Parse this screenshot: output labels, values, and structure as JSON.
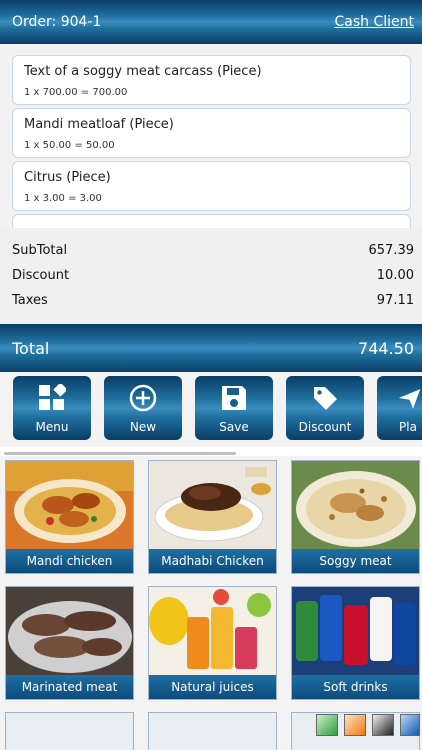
{
  "header": {
    "order_label": "Order: 904-1",
    "client_label": "Cash Client"
  },
  "items": [
    {
      "name": "Text of a soggy meat carcass (Piece)",
      "calc": "1 x 700.00 = 700.00"
    },
    {
      "name": "Mandi meatloaf (Piece)",
      "calc": "1 x 50.00 = 50.00"
    },
    {
      "name": "Citrus (Piece)",
      "calc": "1 x 3.00 = 3.00"
    }
  ],
  "totals": {
    "subtotal_label": "SubTotal",
    "subtotal_value": "657.39",
    "discount_label": "Discount",
    "discount_value": "10.00",
    "taxes_label": "Taxes",
    "taxes_value": "97.11",
    "total_label": "Total",
    "total_value": "744.50"
  },
  "toolbar": [
    {
      "label": "Menu",
      "icon": "menu-icon"
    },
    {
      "label": "New",
      "icon": "plus-circle-icon"
    },
    {
      "label": "Save",
      "icon": "floppy-disk-icon"
    },
    {
      "label": "Discount",
      "icon": "tag-icon"
    },
    {
      "label": "Pla",
      "icon": "send-icon"
    }
  ],
  "products": [
    {
      "label": "Mandi chicken"
    },
    {
      "label": "Madhabi Chicken"
    },
    {
      "label": "Soggy meat"
    },
    {
      "label": "Marinated meat"
    },
    {
      "label": "Natural juices"
    },
    {
      "label": "Soft drinks"
    }
  ],
  "colors": {
    "accent": "#155a8a",
    "accent_light": "#3a8dbd",
    "background": "#f2f2f2"
  },
  "theme_swatches": [
    "#4caf50",
    "#ff9800",
    "#333333",
    "#1565c0"
  ]
}
